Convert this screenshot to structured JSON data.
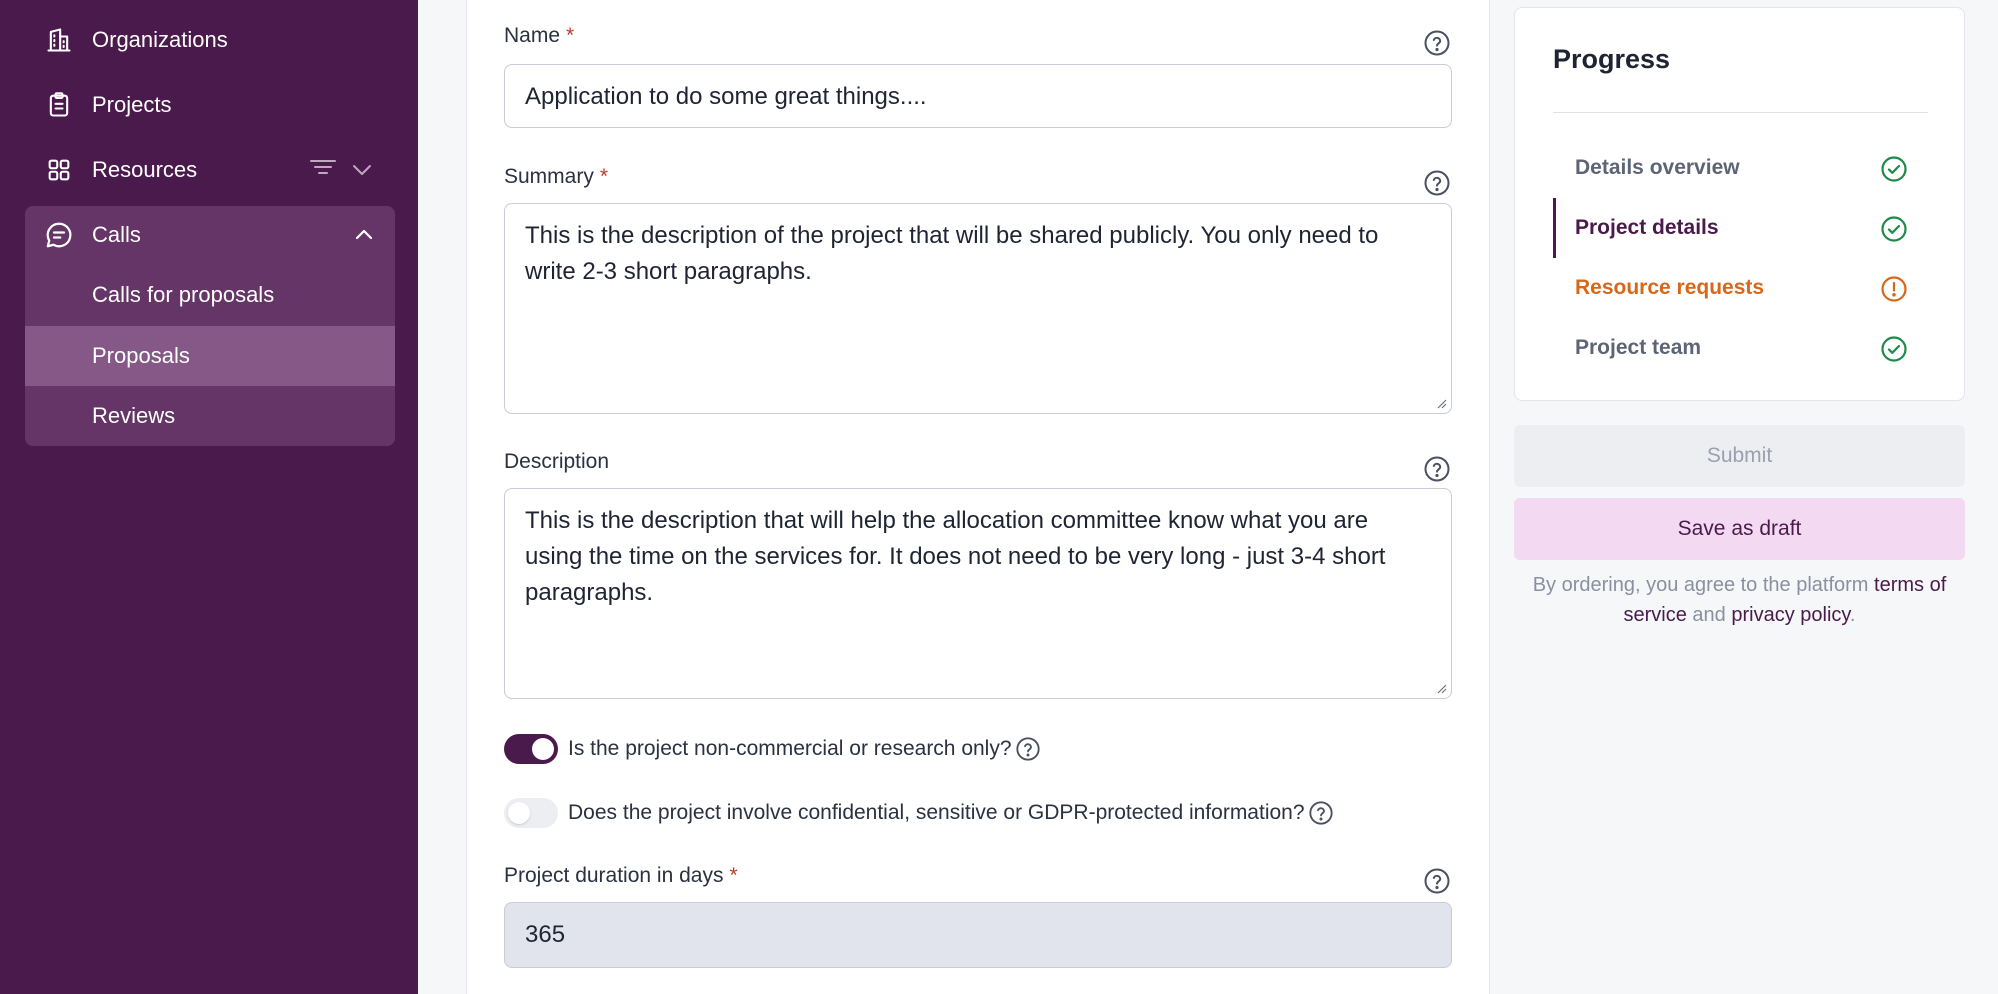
{
  "sidebar": {
    "items": [
      {
        "label": "Organizations",
        "icon": "building-icon"
      },
      {
        "label": "Projects",
        "icon": "clipboard-icon"
      },
      {
        "label": "Resources",
        "icon": "grid-icon"
      }
    ],
    "calls": {
      "label": "Calls",
      "icon": "chat-icon",
      "sub_items": [
        {
          "label": "Calls for proposals",
          "active": false
        },
        {
          "label": "Proposals",
          "active": true
        },
        {
          "label": "Reviews",
          "active": false
        }
      ]
    }
  },
  "form": {
    "name": {
      "label": "Name",
      "required_mark": "*",
      "value": "Application to do some great things...."
    },
    "summary": {
      "label": "Summary",
      "required_mark": "*",
      "value": "This is the description of the project that will be shared publicly. You only need to write 2-3 short paragraphs."
    },
    "description": {
      "label": "Description",
      "value": "This is the description that will help the allocation committee know what you are using the time on the services for. It does not need to be very long - just 3-4 short paragraphs."
    },
    "non_commercial": {
      "label": "Is the project non-commercial or research only?",
      "checked": true
    },
    "confidential": {
      "label": "Does the project involve confidential, sensitive or GDPR-protected information?",
      "checked": false
    },
    "duration": {
      "label": "Project duration in days",
      "required_mark": "*",
      "value": "365"
    }
  },
  "progress": {
    "title": "Progress",
    "steps": [
      {
        "label": "Details overview",
        "status": "complete"
      },
      {
        "label": "Project details",
        "status": "complete",
        "current": true
      },
      {
        "label": "Resource requests",
        "status": "warning"
      },
      {
        "label": "Project team",
        "status": "complete"
      }
    ]
  },
  "actions": {
    "submit_label": "Submit",
    "draft_label": "Save as draft"
  },
  "terms": {
    "prefix": "By ordering, you agree to the platform ",
    "tos_link": "terms of service",
    "middle": " and ",
    "privacy_link": "privacy policy",
    "suffix": "."
  },
  "colors": {
    "sidebar_bg": "#4a1a4c",
    "accent": "#4a1a4c",
    "success": "#1e8a4a",
    "warning": "#d9671a"
  }
}
